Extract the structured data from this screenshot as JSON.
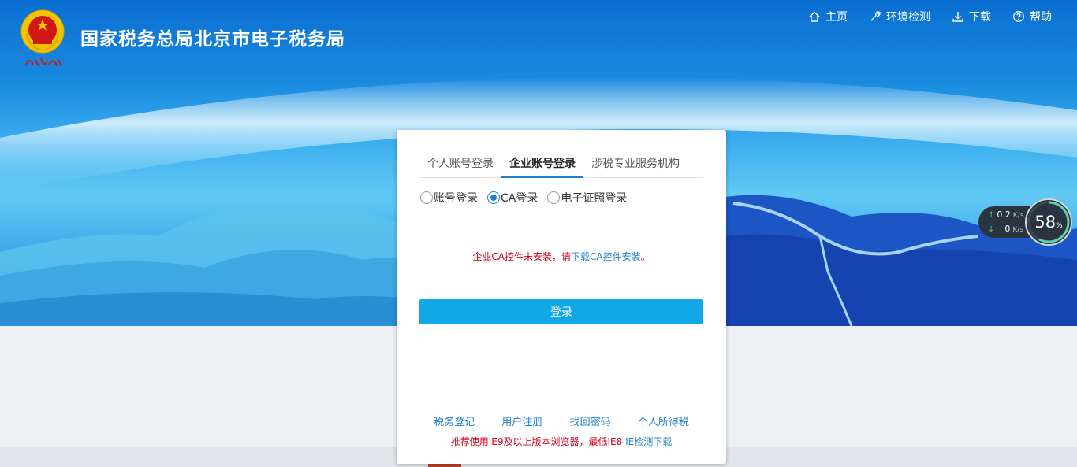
{
  "header": {
    "title": "国家税务总局北京市电子税务局",
    "emblem_script": "中国税务",
    "nav": [
      {
        "label": "主页",
        "icon": "home-icon"
      },
      {
        "label": "环境检测",
        "icon": "wrench-icon"
      },
      {
        "label": "下载",
        "icon": "download-icon"
      },
      {
        "label": "帮助",
        "icon": "help-icon"
      }
    ]
  },
  "login": {
    "tabs": [
      "个人账号登录",
      "企业账号登录",
      "涉税专业服务机构"
    ],
    "active_tab": "企业账号登录",
    "radios": [
      "账号登录",
      "CA登录",
      "电子证照登录"
    ],
    "selected_radio": "CA登录",
    "warning": {
      "text": "企业CA控件未安装，请",
      "link": "下载CA控件安装",
      "end": "。"
    },
    "submit_label": "登录",
    "links": [
      "税务登记",
      "用户注册",
      "找回密码",
      "个人所得税"
    ],
    "browser_tip": {
      "text": "推荐使用IE9及以上版本浏览器，最低IE8 ",
      "link": "IE检测下载"
    }
  },
  "speed_widget": {
    "upload": "0.2",
    "upload_unit": "K/s",
    "download": "0",
    "download_unit": "K/s",
    "percent": "58",
    "percent_sign": "%",
    "percent_value": 58
  },
  "colors": {
    "accent": "#1e7fcf",
    "button": "#12a8e8",
    "warning": "#d9001b"
  }
}
